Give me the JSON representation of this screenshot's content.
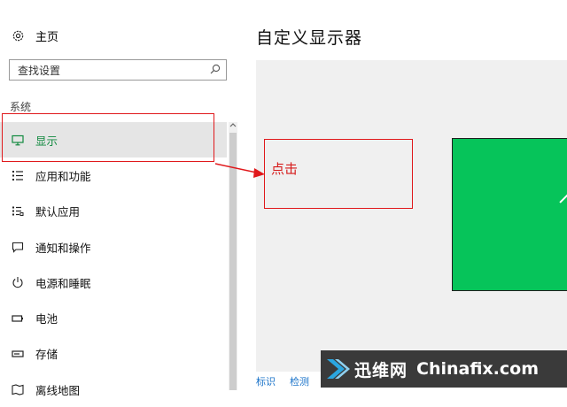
{
  "sidebar": {
    "home_label": "主页",
    "search_placeholder": "查找设置",
    "section_label": "系统",
    "items": [
      {
        "label": "显示",
        "icon": "monitor-icon",
        "active": true
      },
      {
        "label": "应用和功能",
        "icon": "apps-list-icon"
      },
      {
        "label": "默认应用",
        "icon": "default-apps-icon"
      },
      {
        "label": "通知和操作",
        "icon": "notification-icon"
      },
      {
        "label": "电源和睡眠",
        "icon": "power-icon"
      },
      {
        "label": "电池",
        "icon": "battery-icon"
      },
      {
        "label": "存储",
        "icon": "storage-icon"
      },
      {
        "label": "离线地图",
        "icon": "offline-maps-icon"
      }
    ]
  },
  "main": {
    "title": "自定义显示器",
    "links": [
      "标识",
      "检测"
    ]
  },
  "annotation": {
    "click_text": "点击"
  },
  "watermark": {
    "cn": "迅维网",
    "en": "Chinafix.com"
  },
  "colors": {
    "accent": "#10893e",
    "monitor": "#06c45a",
    "annotation": "#e0181b",
    "link": "#1a73c9"
  }
}
